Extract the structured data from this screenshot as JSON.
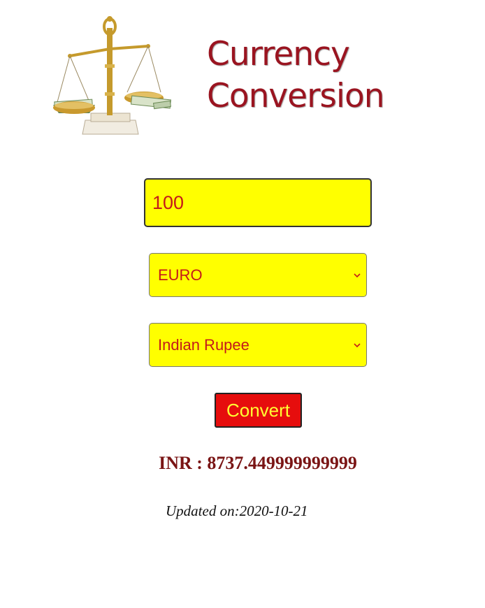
{
  "header": {
    "title_line1": "Currency",
    "title_line2": "Conversion",
    "logo_icon": "balance-scale-with-money-icon"
  },
  "form": {
    "amount_value": "100",
    "from_currency": "EURO",
    "to_currency": "Indian Rupee",
    "convert_label": "Convert",
    "dropdown_icon": "chevron-down-icon"
  },
  "result": {
    "text": "INR : 8737.449999999999"
  },
  "updated": {
    "text": "Updated on:2020-10-21"
  },
  "colors": {
    "field_background": "#ffff00",
    "field_text": "#c41a1a",
    "button_background": "#e60d0d",
    "button_text": "#ffff33",
    "title": "#9a1420",
    "result": "#7a1515"
  }
}
